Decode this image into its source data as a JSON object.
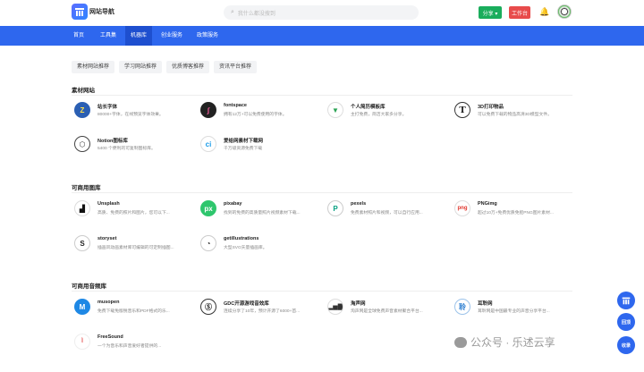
{
  "header": {
    "site_name": "网站导航",
    "search_placeholder": "我什么都没搜到",
    "share_label": "分享 ▾",
    "work_label": "工作台"
  },
  "nav": {
    "items": [
      "首页",
      "工具集",
      "机器库",
      "创业服务",
      "政策服务"
    ],
    "active": "机器库"
  },
  "filters": [
    "素材网站推荐",
    "学习网站推荐",
    "优质博客推荐",
    "资讯平台推荐"
  ],
  "sections": [
    {
      "title": "素材网站",
      "cards": [
        {
          "title": "站长字体",
          "desc": "80000+字体，在线预览字体效果。",
          "icon": "z-icon",
          "color": "#2b5fb3"
        },
        {
          "title": "fontspace",
          "desc": "拥有12万+可以免费使用的字体。",
          "icon": "fontspace-icon",
          "color": "#222"
        },
        {
          "title": "个人简历模板库",
          "desc": "主打免费，简洁大家多分享。",
          "icon": "resume-icon",
          "color": "#fff"
        },
        {
          "title": "3D打印物品",
          "desc": "可以免费下载的物品高清3D模型文件。",
          "icon": "t-icon",
          "color": "#fff"
        },
        {
          "title": "Notion图标库",
          "desc": "5400 个便利的可复制图标库。",
          "icon": "cube-icon",
          "color": "#fff"
        },
        {
          "title": "爱给网素材下载网",
          "desc": "千万级资源免费下载",
          "icon": "aigei-icon",
          "color": "#fff"
        }
      ]
    },
    {
      "title": "可商用图库",
      "cards": [
        {
          "title": "Unsplash",
          "desc": "高质、免费的照片和图片，您可以下...",
          "icon": "unsplash-icon",
          "color": "#fff"
        },
        {
          "title": "pixabay",
          "desc": "找到的免费的高质量照片视频素材下载...",
          "icon": "pixabay-icon",
          "color": "#2ec66d"
        },
        {
          "title": "pexels",
          "desc": "免费素材照片和视频，可以自行应用...",
          "icon": "pexels-icon",
          "color": "#05a081"
        },
        {
          "title": "PNGimg",
          "desc": "超过10万+免费优质免抠PNG图片素材...",
          "icon": "png-icon",
          "color": "#fff"
        },
        {
          "title": "storyset",
          "desc": "插画风动画素材库可编辑的可定制插图...",
          "icon": "storyset-icon",
          "color": "#fff"
        },
        {
          "title": "getillustrations",
          "desc": "大型SVG矢量插画库。",
          "icon": "getillus-icon",
          "color": "#fff"
        }
      ]
    },
    {
      "title": "可商用音频库",
      "cards": [
        {
          "title": "musopen",
          "desc": "免费下载免版税音乐和PDF格式的乐...",
          "icon": "musopen-icon",
          "color": "#1e88e5"
        },
        {
          "title": "GDC开源游戏音效库",
          "desc": "连续分享了10年，预计开源了6000+首...",
          "icon": "gdc-icon",
          "color": "#fff"
        },
        {
          "title": "淘声网",
          "desc": "淘声网是全球免费声音素材聚合平台...",
          "icon": "taosheng-icon",
          "color": "#fff"
        },
        {
          "title": "耳聆网",
          "desc": "耳聆网是中国最专业的声音分享平台...",
          "icon": "erling-icon",
          "color": "#fff"
        },
        {
          "title": "FreeSound",
          "desc": "一个为音乐和声音爱好者提供的...",
          "icon": "freesound-icon",
          "color": "#fff"
        }
      ]
    }
  ],
  "floating": {
    "btn2": "回顶",
    "btn3": "收录"
  },
  "watermark": "公众号 · 乐述云享"
}
